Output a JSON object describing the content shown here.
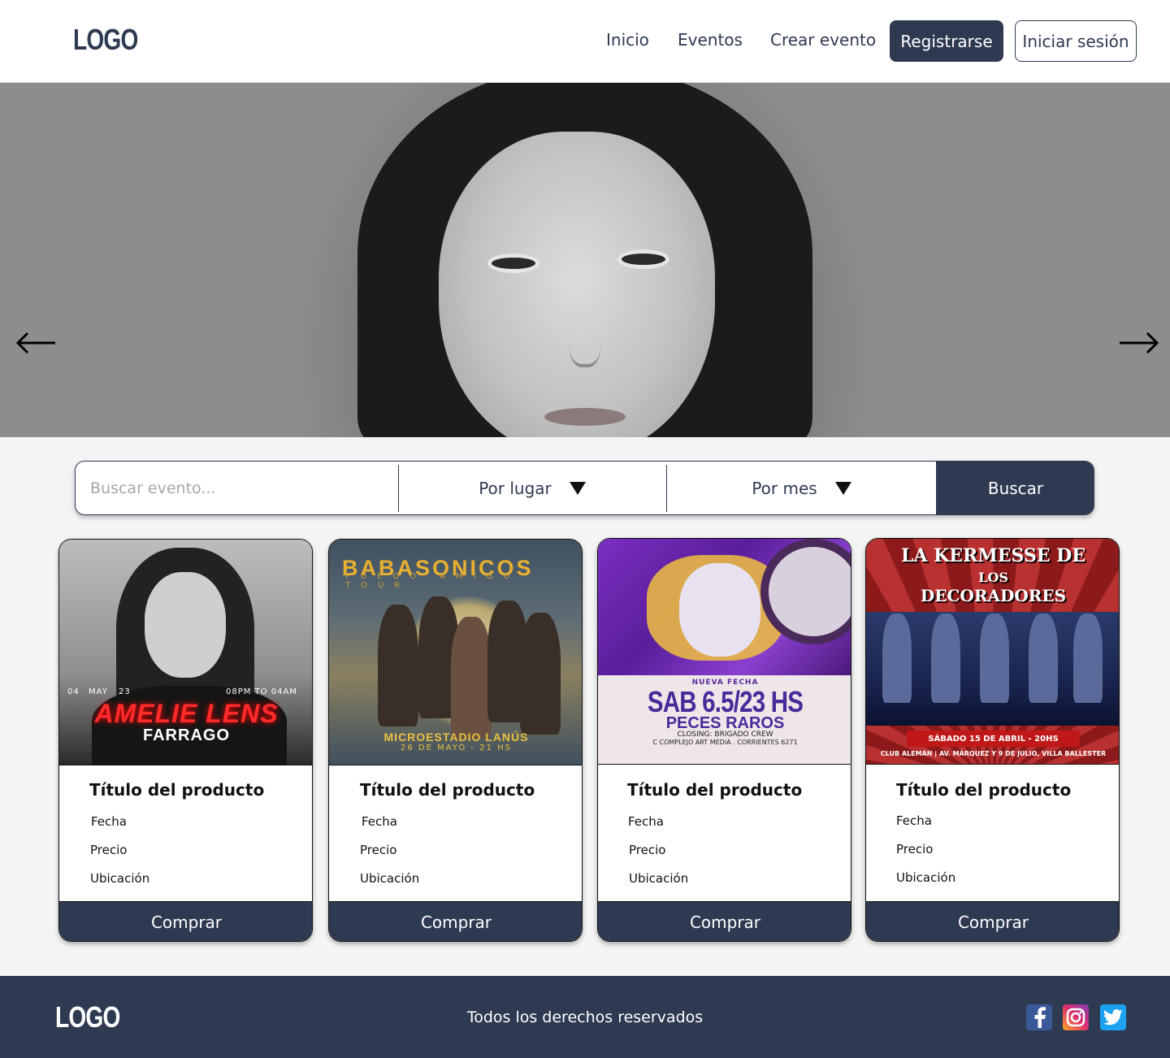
{
  "header": {
    "logo": "LOGO",
    "nav": [
      "Inicio",
      "Eventos",
      "Crear evento"
    ],
    "register_label": "Registrarse",
    "login_label": "Iniciar sesión"
  },
  "hero": {
    "slide_count": 5,
    "active_slide": 4
  },
  "search": {
    "placeholder": "Buscar evento...",
    "place_filter": "Por lugar",
    "month_filter": "Por mes",
    "button_label": "Buscar"
  },
  "cards": [
    {
      "title": "Título del producto",
      "date_label": "Fecha",
      "price_label": "Precio",
      "location_label": "Ubicación",
      "button_label": "Comprar",
      "poster": {
        "day": "04",
        "month": "MAY",
        "year": "23",
        "time": "08PM  TO  04AM",
        "artist": "AMELIE LENS",
        "venue": "FARRAGO"
      }
    },
    {
      "title": "Título del producto",
      "date_label": "Fecha",
      "price_label": "Precio",
      "location_label": "Ubicación",
      "button_label": "Comprar",
      "poster": {
        "artist": "BABASONICOS",
        "tour": "FUEGO AMIGO TOUR",
        "venue": "MICROESTADIO LANÚS",
        "date": "26 DE MAYO - 21 HS"
      }
    },
    {
      "title": "Título del producto",
      "date_label": "Fecha",
      "price_label": "Precio",
      "location_label": "Ubicación",
      "button_label": "Comprar",
      "poster": {
        "tag": "NUEVA FECHA",
        "date": "SAB 6.5/23 HS",
        "artist": "PECES RAROS",
        "closing": "CLOSING: BRIGADO CREW",
        "venue": "C COMPLEJO ART MEDIA . CORRIENTES 6271"
      }
    },
    {
      "title": "Título del producto",
      "date_label": "Fecha",
      "price_label": "Precio",
      "location_label": "Ubicación",
      "button_label": "Comprar",
      "poster": {
        "line1": "LA KERMESSE DE",
        "line2": "LOS",
        "line3": "DECORADORES",
        "date": "SÁBADO 15 DE ABRIL - 20HS",
        "venue": "CLUB ALEMÁN | AV. MÁRQUEZ Y 9 DE JULIO, VILLA BALLESTER"
      }
    }
  ],
  "footer": {
    "logo": "LOGO",
    "copyright": "Todos los derechos reservados",
    "social": [
      "facebook-icon",
      "instagram-icon",
      "twitter-icon"
    ]
  },
  "colors": {
    "primary": "#2e3a52",
    "background": "#f4f4f4"
  }
}
